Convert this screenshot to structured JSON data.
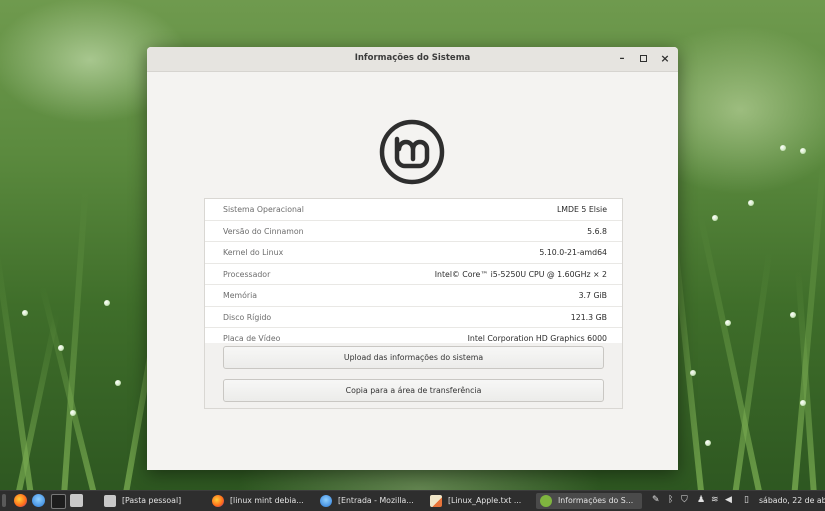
{
  "window": {
    "title": "Informações do Sistema",
    "minimize_glyph": "–",
    "maximize_glyph": "□",
    "close_glyph": "×"
  },
  "info": {
    "rows": [
      {
        "label": "Sistema Operacional",
        "value": "LMDE 5 Elsie"
      },
      {
        "label": "Versão do Cinnamon",
        "value": "5.6.8"
      },
      {
        "label": "Kernel do Linux",
        "value": "5.10.0-21-amd64"
      },
      {
        "label": "Processador",
        "value": "Intel© Core™ i5-5250U CPU @ 1.60GHz × 2"
      },
      {
        "label": "Memória",
        "value": "3.7 GiB"
      },
      {
        "label": "Disco Rígido",
        "value": "121.3 GB"
      },
      {
        "label": "Placa de Vídeo",
        "value": "Intel Corporation HD Graphics 6000"
      }
    ],
    "upload_button": "Upload das informações do sistema",
    "copy_button": "Copia para a área de transferência"
  },
  "taskbar": {
    "tasks": [
      {
        "label": "[Pasta pessoal]",
        "icon": "folder-icon"
      },
      {
        "label": "[linux mint debia...",
        "icon": "firefox-icon"
      },
      {
        "label": "[Entrada - Mozilla...",
        "icon": "thunderbird-icon"
      },
      {
        "label": "[Linux_Apple.txt ...",
        "icon": "text-editor-icon"
      },
      {
        "label": "Informações do S...",
        "icon": "system-info-icon"
      }
    ],
    "clock": "sábado, 22 de ab"
  },
  "colors": {
    "accent_green": "#7fb53f",
    "logo_dark": "#2e2e2e",
    "taskbar_bg": "#2e2e2e"
  }
}
